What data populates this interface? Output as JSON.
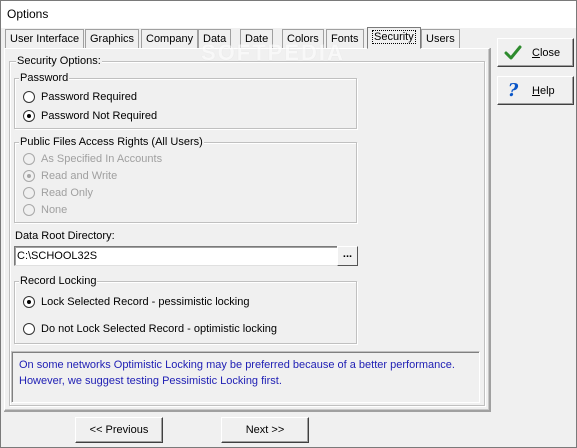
{
  "window": {
    "title": "Options"
  },
  "tabs": [
    {
      "label": "User Interface",
      "active": false
    },
    {
      "label": "Graphics",
      "active": false
    },
    {
      "label": "Company",
      "active": false
    },
    {
      "label": "Data",
      "active": false
    },
    {
      "label": "Date",
      "active": false
    },
    {
      "label": "Colors",
      "active": false
    },
    {
      "label": "Fonts",
      "active": false
    },
    {
      "label": "Security",
      "active": true
    },
    {
      "label": "Users",
      "active": false
    }
  ],
  "security": {
    "section_label": "Security Options:",
    "password": {
      "group_label": "Password",
      "options": [
        {
          "label": "Password Required",
          "checked": false
        },
        {
          "label": "Password Not Required",
          "checked": true
        }
      ]
    },
    "public_files": {
      "group_label": "Public Files Access Rights (All Users)",
      "options": [
        {
          "label": "As Specified In Accounts",
          "checked": false
        },
        {
          "label": "Read and Write",
          "checked": true
        },
        {
          "label": "Read Only",
          "checked": false
        },
        {
          "label": "None",
          "checked": false
        }
      ]
    },
    "data_root": {
      "label": "Data Root Directory:",
      "value": "C:\\SCHOOL32S",
      "browse_label": "..."
    },
    "record_locking": {
      "group_label": "Record Locking",
      "options": [
        {
          "label": "Lock Selected Record - pessimistic locking",
          "checked": true
        },
        {
          "label": "Do not Lock Selected Record - optimistic locking",
          "checked": false
        }
      ]
    },
    "info_line1": "On some networks Optimistic Locking may be preferred because of a better performance.",
    "info_line2": "However, we suggest testing Pessimistic Locking first."
  },
  "side_buttons": {
    "close_label": "Close",
    "help_label": "Help"
  },
  "nav": {
    "previous_label": "<< Previous",
    "next_label": "Next >>"
  },
  "watermark": "SOFTPEDIA",
  "colors": {
    "info_text": "#1e1eb4",
    "check_green": "#2e8b2e",
    "help_blue": "#0a56c8"
  }
}
